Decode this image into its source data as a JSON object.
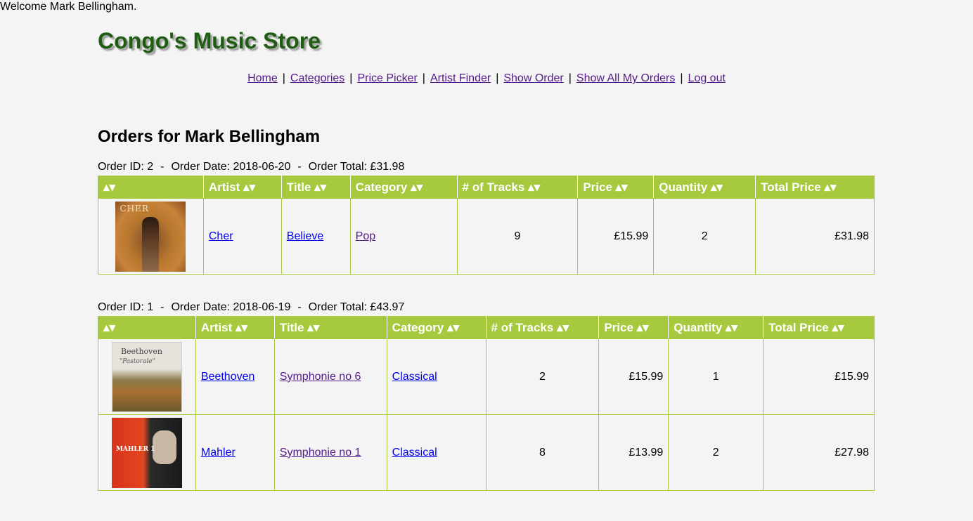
{
  "welcome": "Welcome Mark Bellingham.",
  "store_title": "Congo's Music Store",
  "nav": {
    "items": [
      "Home",
      "Categories",
      "Price Picker",
      "Artist Finder",
      "Show Order",
      "Show All My Orders",
      "Log out"
    ],
    "separator": "|"
  },
  "orders_heading": "Orders for Mark Bellingham",
  "summary_separator": "-",
  "columns": [
    "▴▾",
    "Artist ▴▾",
    "Title ▴▾",
    "Category ▴▾",
    "# of Tracks ▴▾",
    "Price ▴▾",
    "Quantity ▴▾",
    "Total Price ▴▾"
  ],
  "orders": [
    {
      "id_text": "Order ID: 2",
      "date_text": "Order Date: 2018-06-20",
      "total_text": "Order Total: £31.98",
      "rows": [
        {
          "cover_icon": "cher-album-cover",
          "cover_text": "CHER",
          "artist": "Cher",
          "title": "Believe",
          "category": "Pop",
          "tracks": "9",
          "price": "£15.99",
          "quantity": "2",
          "total": "£31.98"
        }
      ]
    },
    {
      "id_text": "Order ID: 1",
      "date_text": "Order Date: 2018-06-19",
      "total_text": "Order Total: £43.97",
      "rows": [
        {
          "cover_icon": "beethoven-album-cover",
          "cover_text": "Beethoven",
          "cover_subtext": "\"Pastorale\"",
          "artist": "Beethoven",
          "title": "Symphonie no 6",
          "category": "Classical",
          "tracks": "2",
          "price": "£15.99",
          "quantity": "1",
          "total": "£15.99"
        },
        {
          "cover_icon": "mahler-album-cover",
          "cover_text": "MAHLER 1",
          "artist": "Mahler",
          "title": "Symphonie no 1",
          "category": "Classical",
          "tracks": "8",
          "price": "£13.99",
          "quantity": "2",
          "total": "£27.98"
        }
      ]
    }
  ],
  "colors": {
    "background": "#f4f4f4",
    "title_green": "#1f5e12",
    "table_header": "#a6c93d",
    "link_blue": "#0000ee",
    "link_visited": "#551a8b"
  }
}
